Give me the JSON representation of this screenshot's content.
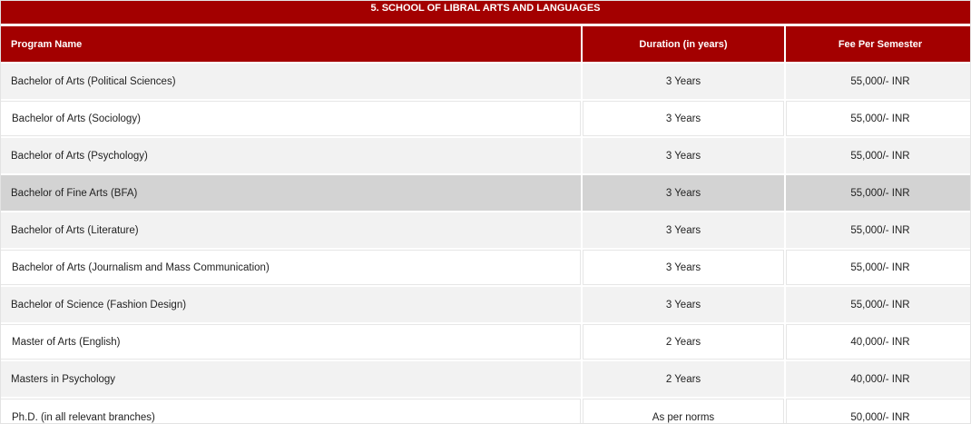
{
  "table": {
    "title": "5. SCHOOL OF LIBRAL ARTS AND LANGUAGES",
    "headers": [
      "Program Name",
      "Duration (in years)",
      "Fee Per Semester"
    ],
    "rows": [
      [
        "Bachelor of Arts (Political Sciences)",
        "3 Years",
        "55,000/- INR"
      ],
      [
        "Bachelor of Arts (Sociology)",
        "3 Years",
        "55,000/- INR"
      ],
      [
        "Bachelor of Arts (Psychology)",
        "3 Years",
        "55,000/- INR"
      ],
      [
        "Bachelor of Fine Arts (BFA)",
        "3 Years",
        "55,000/- INR"
      ],
      [
        "Bachelor of Arts (Literature)",
        "3 Years",
        "55,000/- INR"
      ],
      [
        "Bachelor of Arts (Journalism and Mass Communication)",
        "3 Years",
        "55,000/- INR"
      ],
      [
        "Bachelor of Science (Fashion Design)",
        "3 Years",
        "55,000/- INR"
      ],
      [
        "Master of Arts (English)",
        "2 Years",
        "40,000/- INR"
      ],
      [
        "Masters in Psychology",
        "2 Years",
        "40,000/- INR"
      ],
      [
        "Ph.D. (in all relevant branches)",
        "As per norms",
        "50,000/- INR"
      ]
    ],
    "colors": {
      "header_bg": "#a30000",
      "header_text": "#ffffff",
      "row_alt_bg": "#f2f2f2",
      "row_highlight_bg": "#d3d3d3"
    }
  }
}
